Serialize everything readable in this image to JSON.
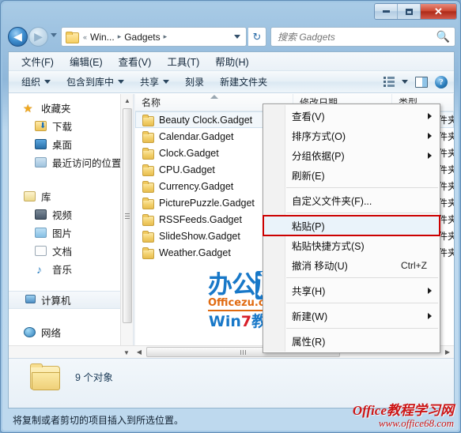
{
  "window": {
    "controls": {
      "minimize": "−",
      "maximize": "□",
      "close": "✕"
    }
  },
  "addressbar": {
    "back_icon": "◀",
    "forward_icon": "▶",
    "crumb_overflow": "«",
    "crumb1": "Win...",
    "crumb_sep": "▸",
    "crumb2": "Gadgets",
    "dropdown_icon": "chevron-down-icon",
    "refresh_icon": "↻"
  },
  "search": {
    "placeholder": "搜索 Gadgets",
    "value": "",
    "icon": "search-icon"
  },
  "menubar": {
    "items": [
      {
        "label": "文件(F)"
      },
      {
        "label": "编辑(E)"
      },
      {
        "label": "查看(V)"
      },
      {
        "label": "工具(T)"
      },
      {
        "label": "帮助(H)"
      }
    ]
  },
  "toolbar": {
    "items": [
      {
        "label": "组织",
        "caret": true
      },
      {
        "label": "包含到库中",
        "caret": true
      },
      {
        "label": "共享",
        "caret": true
      },
      {
        "label": "刻录",
        "caret": false
      },
      {
        "label": "新建文件夹",
        "caret": false
      }
    ],
    "views_icon": "view-options-icon",
    "views_caret": "chevron-down-icon",
    "preview_icon": "preview-pane-icon",
    "help_icon": "help-icon",
    "help_glyph": "?"
  },
  "navpane": {
    "items": [
      {
        "label": "收藏夹",
        "icon": "star-icon",
        "level": 0,
        "selected": false
      },
      {
        "label": "下载",
        "icon": "downloads-icon",
        "level": 1,
        "selected": false
      },
      {
        "label": "桌面",
        "icon": "desktop-icon",
        "level": 1,
        "selected": false
      },
      {
        "label": "最近访问的位置",
        "icon": "recent-places-icon",
        "level": 1,
        "selected": false
      },
      {
        "label": "库",
        "icon": "libraries-icon",
        "level": 0,
        "selected": false
      },
      {
        "label": "视频",
        "icon": "videos-icon",
        "level": 1,
        "selected": false
      },
      {
        "label": "图片",
        "icon": "pictures-icon",
        "level": 1,
        "selected": false
      },
      {
        "label": "文档",
        "icon": "documents-icon",
        "level": 1,
        "selected": false
      },
      {
        "label": "音乐",
        "icon": "music-icon",
        "level": 1,
        "selected": false
      },
      {
        "label": "计算机",
        "icon": "computer-icon",
        "level": 0,
        "selected": true
      },
      {
        "label": "网络",
        "icon": "network-icon",
        "level": 0,
        "selected": false
      }
    ]
  },
  "filelist": {
    "columns": [
      {
        "label": "名称"
      },
      {
        "label": "修改日期"
      },
      {
        "label": "类型"
      }
    ],
    "rows": [
      {
        "name": "Beauty Clock.Gadget",
        "type": "文件夹",
        "focused": true
      },
      {
        "name": "Calendar.Gadget",
        "type": "文件夹",
        "focused": false
      },
      {
        "name": "Clock.Gadget",
        "type": "文件夹",
        "focused": false
      },
      {
        "name": "CPU.Gadget",
        "type": "文件夹",
        "focused": false
      },
      {
        "name": "Currency.Gadget",
        "type": "文件夹",
        "focused": false
      },
      {
        "name": "PicturePuzzle.Gadget",
        "type": "文件夹",
        "focused": false
      },
      {
        "name": "RSSFeeds.Gadget",
        "type": "文件夹",
        "focused": false
      },
      {
        "name": "SlideShow.Gadget",
        "type": "文件夹",
        "focused": false
      },
      {
        "name": "Weather.Gadget",
        "type": "文件夹",
        "focused": false
      }
    ]
  },
  "contextmenu": {
    "items": [
      {
        "label": "查看(V)",
        "submenu": true,
        "accel": "",
        "separator_after": false,
        "highlight": false
      },
      {
        "label": "排序方式(O)",
        "submenu": true,
        "accel": "",
        "separator_after": false,
        "highlight": false
      },
      {
        "label": "分组依据(P)",
        "submenu": true,
        "accel": "",
        "separator_after": false,
        "highlight": false
      },
      {
        "label": "刷新(E)",
        "submenu": false,
        "accel": "",
        "separator_after": true,
        "highlight": false
      },
      {
        "label": "自定义文件夹(F)...",
        "submenu": false,
        "accel": "",
        "separator_after": true,
        "highlight": false
      },
      {
        "label": "粘贴(P)",
        "submenu": false,
        "accel": "",
        "separator_after": false,
        "highlight": true
      },
      {
        "label": "粘贴快捷方式(S)",
        "submenu": false,
        "accel": "",
        "separator_after": false,
        "highlight": false
      },
      {
        "label": "撤消 移动(U)",
        "submenu": false,
        "accel": "Ctrl+Z",
        "separator_after": true,
        "highlight": false
      },
      {
        "label": "共享(H)",
        "submenu": true,
        "accel": "",
        "separator_after": true,
        "highlight": false
      },
      {
        "label": "新建(W)",
        "submenu": true,
        "accel": "",
        "separator_after": true,
        "highlight": false
      },
      {
        "label": "属性(R)",
        "submenu": false,
        "accel": "",
        "separator_after": false,
        "highlight": false
      }
    ],
    "highlight_color": "#cc1111"
  },
  "details": {
    "item_count": "9 个对象",
    "folder_icon": "folder-icon"
  },
  "statusbar": {
    "text": "将复制或者剪切的项目插入到所选位置。"
  },
  "watermark": {
    "line1_a": "办公",
    "line1_b": "族",
    "line2": "Officezu.com",
    "line3_a": "Win",
    "line3_b": "7",
    "line3_c": "教程"
  },
  "watermark2": {
    "line1": "Office教程学习网",
    "line2": "www.office68.com"
  },
  "scrollbars": {
    "up_arrow": "▲",
    "down_arrow": "▼",
    "left_arrow": "◀",
    "right_arrow": "▶"
  }
}
